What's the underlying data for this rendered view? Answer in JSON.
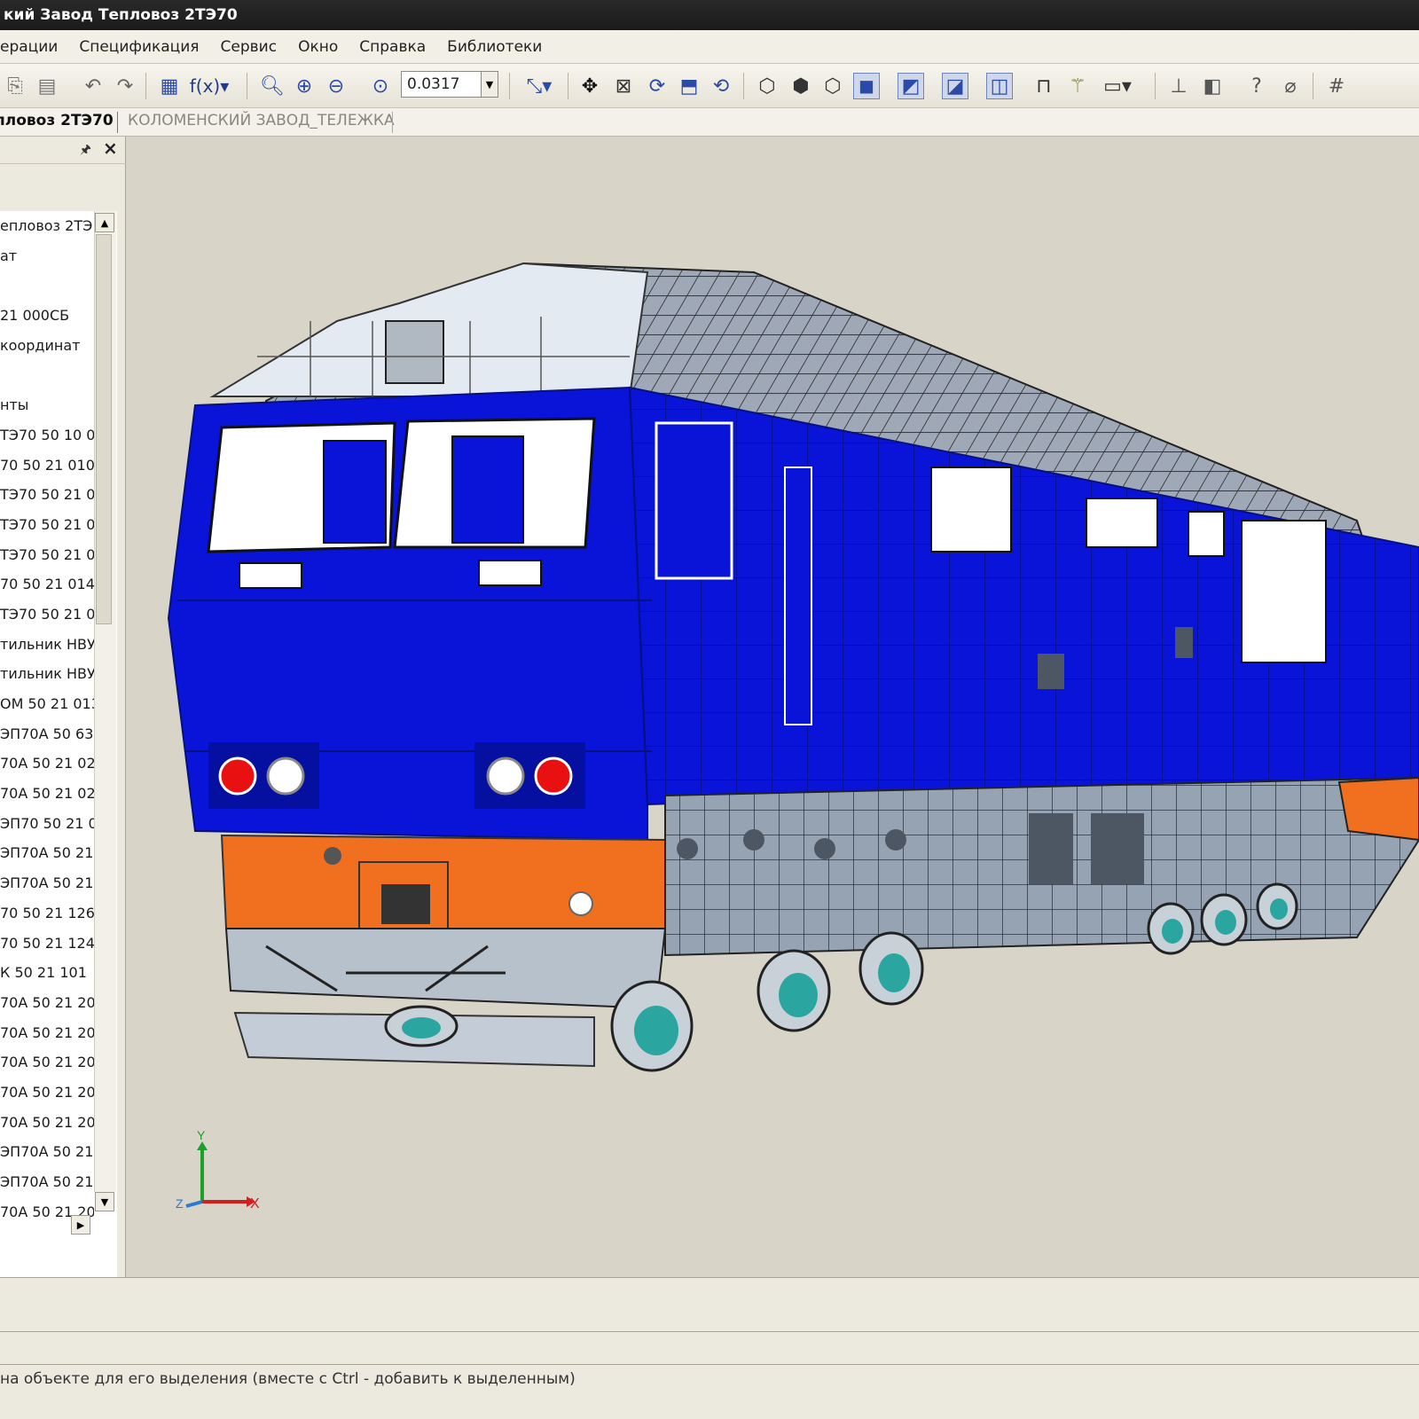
{
  "window": {
    "title": "кий Завод Тепловоз 2ТЭ70"
  },
  "menu": {
    "items": [
      "ерации",
      "Спецификация",
      "Сервис",
      "Окно",
      "Справка",
      "Библиотеки"
    ]
  },
  "toolbar": {
    "zoom_value": "0.0317",
    "icons": [
      "copy-icon",
      "paste-icon",
      "undo-icon",
      "redo-icon",
      "variables-icon",
      "function-icon",
      "zoom-window-icon",
      "zoom-in-icon",
      "zoom-out-icon",
      "zoom-scale-icon",
      "axis-icon",
      "pan-icon",
      "zoom-fit-icon",
      "rotate-icon",
      "rotate-plane-icon",
      "rotate-center-icon",
      "view-front-icon",
      "view-iso-icon",
      "view-back-icon",
      "shaded-icon",
      "shaded-edges-icon",
      "section-icon",
      "perspective-icon",
      "measure-icon",
      "wand-icon",
      "display-icon",
      "constraint-icon",
      "layer-icon",
      "help-icon",
      "magnet-icon",
      "grid-icon"
    ]
  },
  "tabs": {
    "active": "пловоз 2ТЭ70",
    "second": "КОЛОМЕНСКИЙ ЗАВОД_ТЕЛЕЖКА"
  },
  "tree": {
    "items": [
      "епловоз 2ТЭ",
      "ат",
      "",
      "21 000СБ",
      " координат",
      "",
      "нты",
      "ТЭ70 50 10 0",
      "70 50 21 010",
      "ТЭ70 50 21 0",
      "ТЭ70 50 21 0",
      "ТЭ70 50 21 0",
      "70 50 21 014",
      "ТЭ70 50 21 0",
      "тильник НВУ",
      "тильник НВУ",
      "ОМ 50 21 013",
      "ЭП70А 50 63",
      "70А 50 21 02",
      "70А 50 21 02",
      "ЭП70 50 21 0",
      "ЭП70А 50 21",
      "ЭП70А 50 21",
      "70 50 21 126",
      "70 50 21 124",
      "К 50 21 101",
      "70А 50 21 20",
      "70А 50 21 20",
      "70А 50 21 20",
      "70А 50 21 20",
      "70А 50 21 20",
      "ЭП70А 50 21",
      "ЭП70А 50 21",
      "70А 50 21 20"
    ]
  },
  "axes": {
    "x": "X",
    "y": "Y",
    "z": "Z"
  },
  "status": {
    "hint": "на объекте для его выделения (вместе с Ctrl - добавить к выделенным)"
  },
  "colors": {
    "body_blue": "#0a14d8",
    "nose_orange": "#f07020",
    "chassis_grey": "#9aa6b4",
    "wheel_teal": "#2aa5a0",
    "background": "#d8d4c8"
  }
}
